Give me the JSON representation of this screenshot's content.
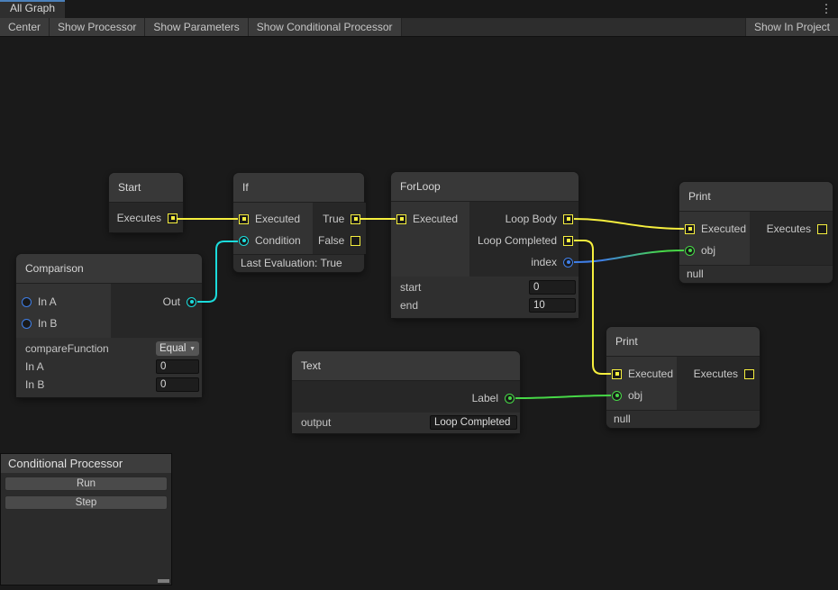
{
  "tab_bar": {
    "active_tab": "All Graph",
    "kebab_menu_icon": "⋮"
  },
  "toolbar": {
    "buttons": [
      "Center",
      "Show Processor",
      "Show Parameters",
      "Show Conditional Processor"
    ],
    "right_button": "Show In Project"
  },
  "nodes": {
    "start": {
      "title": "Start",
      "outputs": [
        {
          "label": "Executes",
          "port": "exec",
          "connected": true
        }
      ]
    },
    "if": {
      "title": "If",
      "inputs": [
        {
          "label": "Executed",
          "port": "exec",
          "connected": true
        },
        {
          "label": "Condition",
          "port": "condition",
          "connected": true
        }
      ],
      "outputs": [
        {
          "label": "True",
          "port": "exec",
          "connected": true
        },
        {
          "label": "False",
          "port": "exec",
          "connected": false
        }
      ],
      "footer": "Last Evaluation: True"
    },
    "forloop": {
      "title": "ForLoop",
      "inputs": [
        {
          "label": "Executed",
          "port": "exec",
          "connected": true
        }
      ],
      "outputs": [
        {
          "label": "Loop Body",
          "port": "exec",
          "connected": true
        },
        {
          "label": "Loop Completed",
          "port": "exec",
          "connected": true
        },
        {
          "label": "index",
          "port": "int",
          "connected": true
        }
      ],
      "fields": [
        {
          "label": "start",
          "value": "0"
        },
        {
          "label": "end",
          "value": "10"
        }
      ]
    },
    "print_top": {
      "title": "Print",
      "inputs": [
        {
          "label": "Executed",
          "port": "exec",
          "connected": true
        },
        {
          "label": "obj",
          "port": "object",
          "connected": true
        }
      ],
      "outputs": [
        {
          "label": "Executes",
          "port": "exec",
          "connected": false
        }
      ],
      "footer": "null"
    },
    "comparison": {
      "title": "Comparison",
      "inputs": [
        {
          "label": "In A",
          "port": "int",
          "connected": false
        },
        {
          "label": "In B",
          "port": "int",
          "connected": false
        }
      ],
      "outputs": [
        {
          "label": "Out",
          "port": "condition",
          "connected": true
        }
      ],
      "fields": [
        {
          "label": "compareFunction",
          "value": "Equal"
        },
        {
          "label": "In A",
          "value": "0"
        },
        {
          "label": "In B",
          "value": "0"
        }
      ]
    },
    "text": {
      "title": "Text",
      "outputs": [
        {
          "label": "Label",
          "port": "object",
          "connected": true
        }
      ],
      "fields": [
        {
          "label": "output",
          "value": "Loop Completed"
        }
      ]
    },
    "print_bottom": {
      "title": "Print",
      "inputs": [
        {
          "label": "Executed",
          "port": "exec",
          "connected": true
        },
        {
          "label": "obj",
          "port": "object",
          "connected": true
        }
      ],
      "outputs": [
        {
          "label": "Executes",
          "port": "exec",
          "connected": false
        }
      ],
      "footer": "null"
    }
  },
  "processor_panel": {
    "title": "Conditional Processor",
    "buttons": [
      "Run",
      "Step"
    ]
  },
  "edges": [
    {
      "from": "Start.Executes",
      "to": "If.Executed",
      "color": "exec"
    },
    {
      "from": "If.True",
      "to": "ForLoop.Executed",
      "color": "exec"
    },
    {
      "from": "Comparison.Out",
      "to": "If.Condition",
      "color": "condition"
    },
    {
      "from": "ForLoop.Loop Body",
      "to": "PrintTop.Executed",
      "color": "exec"
    },
    {
      "from": "ForLoop.Loop Completed",
      "to": "PrintBottom.Executed",
      "color": "exec"
    },
    {
      "from": "ForLoop.index",
      "to": "PrintTop.obj",
      "color": "int-to-object"
    },
    {
      "from": "Text.Label",
      "to": "PrintBottom.obj",
      "color": "object"
    }
  ],
  "colors": {
    "exec": "#f6ef3e",
    "condition": "#1bdcdc",
    "object": "#47d847",
    "int": "#3f7fe8",
    "tab_accent": "#4b80ba",
    "canvas_bg": "#1a1a1a"
  }
}
